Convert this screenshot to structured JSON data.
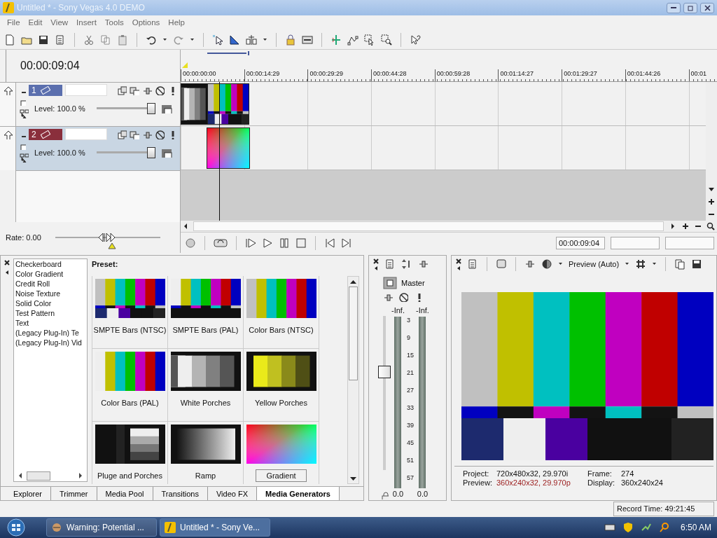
{
  "window": {
    "title": "Untitled * - Sony Vegas 4.0 DEMO"
  },
  "menu": [
    "File",
    "Edit",
    "View",
    "Insert",
    "Tools",
    "Options",
    "Help"
  ],
  "time_display": "00:00:09:04",
  "tracks": [
    {
      "number": "1",
      "color": "#5b6fae",
      "level_text": "Level: 100.0 %",
      "level": 1,
      "selected": false
    },
    {
      "number": "2",
      "color": "#8a2f3c",
      "level_text": "Level: 100.0 %",
      "level": 1,
      "selected": true
    }
  ],
  "rate": {
    "label": "Rate: 0.00",
    "level": 0.5
  },
  "ruler": [
    "00:00:00:00",
    "00:00:14:29",
    "00:00:29:29",
    "00:00:44:28",
    "00:00:59:28",
    "00:01:14:27",
    "00:01:29:27",
    "00:01:44:26",
    "00:01"
  ],
  "transport": {
    "time": "00:00:09:04"
  },
  "generators": {
    "items": [
      "Checkerboard",
      "Color Gradient",
      "Credit Roll",
      "Noise Texture",
      "Solid Color",
      "Test Pattern",
      "Text",
      "(Legacy Plug-In) Te",
      "(Legacy Plug-In) Vid"
    ],
    "preset_label": "Preset:",
    "presets": [
      {
        "label": "SMPTE Bars (NTSC)",
        "kind": "smpte",
        "selected": false
      },
      {
        "label": "SMPTE Bars (PAL)",
        "kind": "smptepal",
        "selected": false
      },
      {
        "label": "Color Bars (NTSC)",
        "kind": "bars",
        "selected": false
      },
      {
        "label": "Color Bars (PAL)",
        "kind": "barspal",
        "selected": false
      },
      {
        "label": "White Porches",
        "kind": "white",
        "selected": false
      },
      {
        "label": "Yellow Porches",
        "kind": "yellow",
        "selected": false
      },
      {
        "label": "Pluge and Porches",
        "kind": "pluge",
        "selected": false
      },
      {
        "label": "Ramp",
        "kind": "ramp",
        "selected": false
      },
      {
        "label": "Gradient",
        "kind": "gradient",
        "selected": true
      }
    ]
  },
  "dock_tabs": [
    {
      "label": "Explorer",
      "selected": false
    },
    {
      "label": "Trimmer",
      "selected": false
    },
    {
      "label": "Media Pool",
      "selected": false
    },
    {
      "label": "Transitions",
      "selected": false
    },
    {
      "label": "Video FX",
      "selected": false
    },
    {
      "label": "Media Generators",
      "selected": true
    }
  ],
  "mixer": {
    "title": "Master",
    "peaks": [
      "-Inf.",
      "-Inf."
    ],
    "scale": [
      "3",
      "9",
      "15",
      "21",
      "27",
      "33",
      "39",
      "45",
      "51",
      "57"
    ],
    "readings": [
      "0.0",
      "0.0"
    ],
    "fader": {
      "level": 0.65
    }
  },
  "preview": {
    "mode": "Preview (Auto)",
    "info": [
      {
        "label": "Project:",
        "value": "720x480x32, 29.970i",
        "highlight": false
      },
      {
        "label": "Frame:",
        "value": "274",
        "highlight": false
      },
      {
        "label": "Preview:",
        "value": "360x240x32, 29.970p",
        "highlight": true
      },
      {
        "label": "Display:",
        "value": "360x240x24",
        "highlight": false
      }
    ]
  },
  "record_time": "Record Time: 49:21:45",
  "taskbar": {
    "tasks": [
      {
        "label": "Warning: Potential ...",
        "selected": false
      },
      {
        "label": "Untitled * - Sony Ve...",
        "selected": true
      }
    ],
    "clock": "6:50 AM"
  }
}
